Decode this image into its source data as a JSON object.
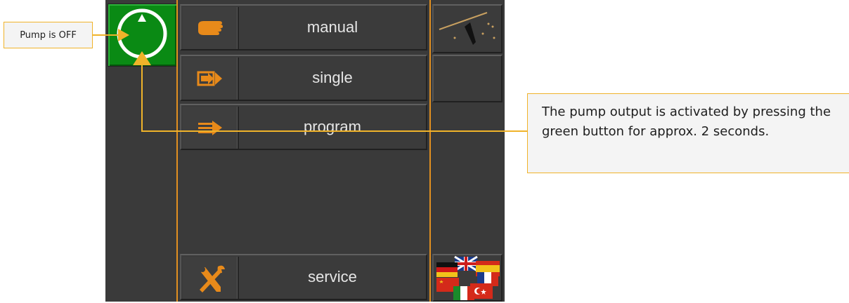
{
  "pump": {
    "status_label": "Pump is OFF",
    "icon": "power-circle-icon",
    "color": "#0a8a14"
  },
  "menu": {
    "items": [
      {
        "label": "manual",
        "icon": "hand-icon"
      },
      {
        "label": "single",
        "icon": "single-arrow-icon"
      },
      {
        "label": "program",
        "icon": "program-arrow-icon"
      },
      {
        "label": "service",
        "icon": "tools-icon"
      }
    ]
  },
  "side": {
    "top_icon": "wiper-icon",
    "bottom_icon": "language-flags-icon"
  },
  "annotation": {
    "text": "The pump output is activated by pressing the green button for approx. 2 seconds."
  },
  "colors": {
    "accent": "#e29020",
    "callout_border": "#f0b32a",
    "panel_bg": "#3a3a3a",
    "label": "#e6e6e6"
  }
}
